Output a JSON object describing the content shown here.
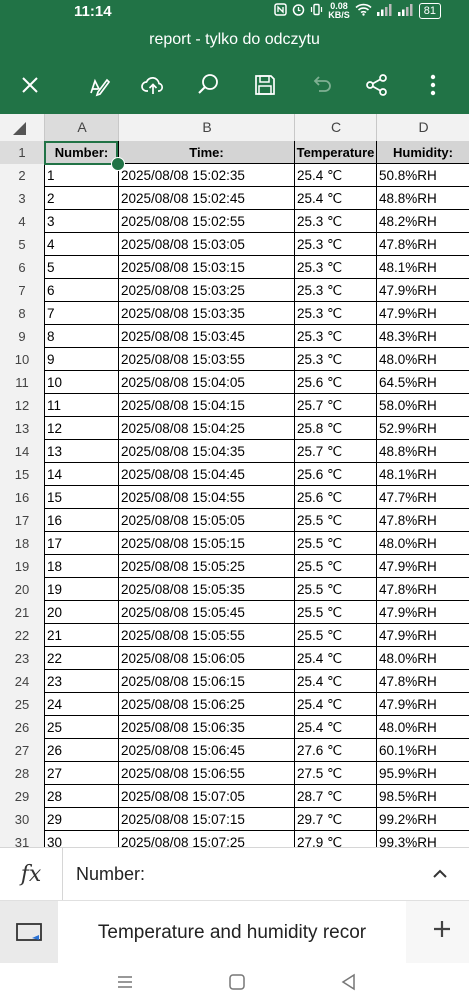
{
  "status": {
    "time": "11:14",
    "speed_top": "0.08",
    "speed_bottom": "KB/S",
    "battery": "81"
  },
  "title": "report - tylko do odczytu",
  "toolbar": {
    "icons": [
      "close-icon",
      "edit-icon",
      "upload-cloud-icon",
      "search-icon",
      "save-icon",
      "undo-icon",
      "share-icon",
      "more-icon"
    ]
  },
  "columns": [
    "A",
    "B",
    "C",
    "D"
  ],
  "header_row": [
    "Number:",
    "Time:",
    "Temperature",
    "Humidity:"
  ],
  "rows": [
    [
      "1",
      "2025/08/08 15:02:35",
      "25.4 ℃",
      "50.8%RH"
    ],
    [
      "2",
      "2025/08/08 15:02:45",
      "25.4 ℃",
      "48.8%RH"
    ],
    [
      "3",
      "2025/08/08 15:02:55",
      "25.3 ℃",
      "48.2%RH"
    ],
    [
      "4",
      "2025/08/08 15:03:05",
      "25.3 ℃",
      "47.8%RH"
    ],
    [
      "5",
      "2025/08/08 15:03:15",
      "25.3 ℃",
      "48.1%RH"
    ],
    [
      "6",
      "2025/08/08 15:03:25",
      "25.3 ℃",
      "47.9%RH"
    ],
    [
      "7",
      "2025/08/08 15:03:35",
      "25.3 ℃",
      "47.9%RH"
    ],
    [
      "8",
      "2025/08/08 15:03:45",
      "25.3 ℃",
      "48.3%RH"
    ],
    [
      "9",
      "2025/08/08 15:03:55",
      "25.3 ℃",
      "48.0%RH"
    ],
    [
      "10",
      "2025/08/08 15:04:05",
      "25.6 ℃",
      "64.5%RH"
    ],
    [
      "11",
      "2025/08/08 15:04:15",
      "25.7 ℃",
      "58.0%RH"
    ],
    [
      "12",
      "2025/08/08 15:04:25",
      "25.8 ℃",
      "52.9%RH"
    ],
    [
      "13",
      "2025/08/08 15:04:35",
      "25.7 ℃",
      "48.8%RH"
    ],
    [
      "14",
      "2025/08/08 15:04:45",
      "25.6 ℃",
      "48.1%RH"
    ],
    [
      "15",
      "2025/08/08 15:04:55",
      "25.6 ℃",
      "47.7%RH"
    ],
    [
      "16",
      "2025/08/08 15:05:05",
      "25.5 ℃",
      "47.8%RH"
    ],
    [
      "17",
      "2025/08/08 15:05:15",
      "25.5 ℃",
      "48.0%RH"
    ],
    [
      "18",
      "2025/08/08 15:05:25",
      "25.5 ℃",
      "47.9%RH"
    ],
    [
      "19",
      "2025/08/08 15:05:35",
      "25.5 ℃",
      "47.8%RH"
    ],
    [
      "20",
      "2025/08/08 15:05:45",
      "25.5 ℃",
      "47.9%RH"
    ],
    [
      "21",
      "2025/08/08 15:05:55",
      "25.5 ℃",
      "47.9%RH"
    ],
    [
      "22",
      "2025/08/08 15:06:05",
      "25.4 ℃",
      "48.0%RH"
    ],
    [
      "23",
      "2025/08/08 15:06:15",
      "25.4 ℃",
      "47.8%RH"
    ],
    [
      "24",
      "2025/08/08 15:06:25",
      "25.4 ℃",
      "47.9%RH"
    ],
    [
      "25",
      "2025/08/08 15:06:35",
      "25.4 ℃",
      "48.0%RH"
    ],
    [
      "26",
      "2025/08/08 15:06:45",
      "27.6 ℃",
      "60.1%RH"
    ],
    [
      "27",
      "2025/08/08 15:06:55",
      "27.5 ℃",
      "95.9%RH"
    ],
    [
      "28",
      "2025/08/08 15:07:05",
      "28.7 ℃",
      "98.5%RH"
    ],
    [
      "29",
      "2025/08/08 15:07:15",
      "29.7 ℃",
      "99.2%RH"
    ],
    [
      "30",
      "2025/08/08 15:07:25",
      "27.9 ℃",
      "99.3%RH"
    ]
  ],
  "formula": {
    "value": "Number:"
  },
  "sheet": {
    "name": "Temperature and humidity recor"
  },
  "colors": {
    "accent": "#217346"
  }
}
